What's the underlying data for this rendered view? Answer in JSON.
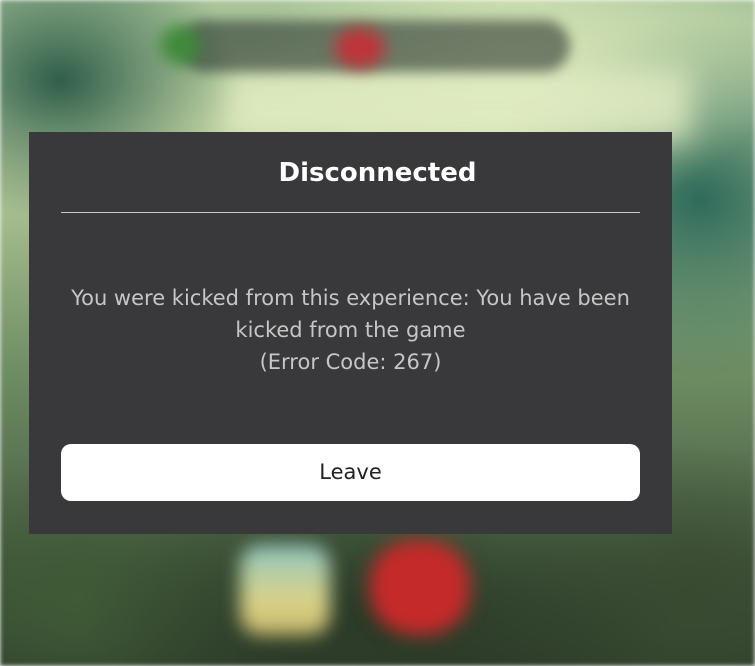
{
  "dialog": {
    "title": "Disconnected",
    "message_line1": "You were kicked from this experience: You have been",
    "message_line2": "kicked from the game",
    "error_code": "(Error Code: 267)",
    "leave_label": "Leave"
  },
  "colors": {
    "dialog_background": "#39393b",
    "title_text": "#ffffff",
    "message_text": "#c6c6c6",
    "divider": "#c9c9c9",
    "button_background": "#ffffff",
    "button_text": "#222222"
  }
}
